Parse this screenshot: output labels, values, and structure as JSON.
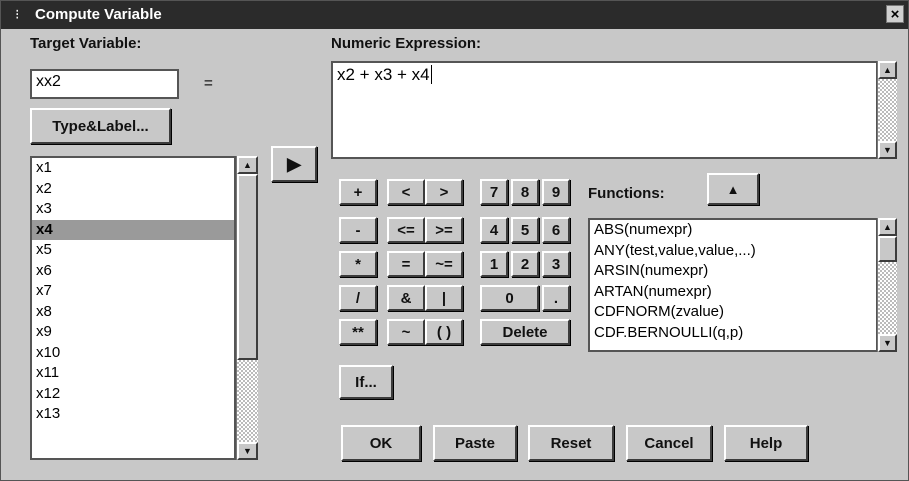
{
  "window": {
    "title": "Compute Variable",
    "close_glyph": "×",
    "sys_glyph": "⁝"
  },
  "target": {
    "label": "Target Variable:",
    "value": "xx2",
    "equals": "="
  },
  "type_label_button": "Type&Label...",
  "expression": {
    "label": "Numeric Expression:",
    "value": "x2 + x3 + x4"
  },
  "transfer_button_glyph": "▶",
  "variables": [
    "x1",
    "x2",
    "x3",
    "x4",
    "x5",
    "x6",
    "x7",
    "x8",
    "x9",
    "x10",
    "x11",
    "x12",
    "x13"
  ],
  "selected_variable": "x4",
  "calculator": {
    "row1": [
      "+",
      "<",
      ">",
      "7",
      "8",
      "9"
    ],
    "row2": [
      "-",
      "<=",
      ">=",
      "4",
      "5",
      "6"
    ],
    "row3": [
      "*",
      "=",
      "~=",
      "1",
      "2",
      "3"
    ],
    "row4": [
      "/",
      "&",
      "|",
      "0",
      "."
    ],
    "row5": [
      "**",
      "~",
      "( )"
    ],
    "delete": "Delete"
  },
  "functions": {
    "label": "Functions:",
    "up_button_glyph": "▲",
    "items": [
      "ABS(numexpr)",
      "ANY(test,value,value,...)",
      "ARSIN(numexpr)",
      "ARTAN(numexpr)",
      "CDFNORM(zvalue)",
      "CDF.BERNOULLI(q,p)"
    ]
  },
  "if_button": "If...",
  "buttons": {
    "ok": "OK",
    "paste": "Paste",
    "reset": "Reset",
    "cancel": "Cancel",
    "help": "Help"
  }
}
